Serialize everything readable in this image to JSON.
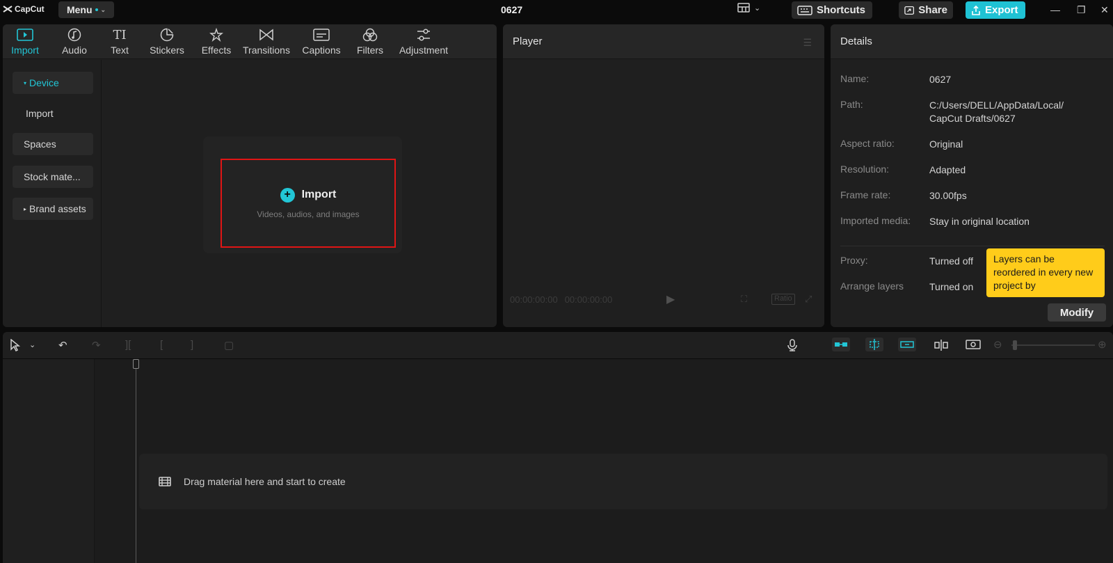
{
  "app": {
    "logo_text": "CapCut",
    "menu_label": "Menu",
    "project_title": "0627",
    "shortcuts_label": "Shortcuts",
    "share_label": "Share",
    "export_label": "Export",
    "accent_color": "#22c6d6"
  },
  "toolbar": {
    "tabs": [
      {
        "label": "Import",
        "icon": "import-icon"
      },
      {
        "label": "Audio",
        "icon": "audio-icon"
      },
      {
        "label": "Text",
        "icon": "text-icon"
      },
      {
        "label": "Stickers",
        "icon": "stickers-icon"
      },
      {
        "label": "Effects",
        "icon": "effects-icon"
      },
      {
        "label": "Transitions",
        "icon": "transitions-icon"
      },
      {
        "label": "Captions",
        "icon": "captions-icon"
      },
      {
        "label": "Filters",
        "icon": "filters-icon"
      },
      {
        "label": "Adjustment",
        "icon": "adjustment-icon"
      }
    ]
  },
  "sidebar": {
    "items": [
      {
        "label": "Device"
      },
      {
        "label": "Import"
      },
      {
        "label": "Spaces"
      },
      {
        "label": "Stock mate..."
      },
      {
        "label": "Brand assets"
      }
    ]
  },
  "import_area": {
    "title": "Import",
    "subtitle": "Videos, audios, and images"
  },
  "player": {
    "title": "Player",
    "current_time": "00:00:00:00",
    "total_time": "00:00:00:00",
    "ratio_label": "Ratio"
  },
  "details": {
    "title": "Details",
    "rows": [
      {
        "key": "Name:",
        "value": "0627"
      },
      {
        "key": "Path:",
        "value": "C:/Users/DELL/AppData/Local/",
        "value2": "CapCut Drafts/0627"
      },
      {
        "key": "Aspect ratio:",
        "value": "Original"
      },
      {
        "key": "Resolution:",
        "value": "Adapted"
      },
      {
        "key": "Frame rate:",
        "value": "30.00fps"
      },
      {
        "key": "Imported media:",
        "value": "Stay in original location"
      },
      {
        "key": "Proxy:",
        "value": "Turned off"
      },
      {
        "key": "Arrange layers",
        "value": "Turned on"
      }
    ],
    "tooltip": "Layers can be reordered in every new project by",
    "modify_label": "Modify",
    "tooltip_color": "#ffcc1a"
  },
  "timeline": {
    "drag_hint": "Drag material here and start to create"
  }
}
